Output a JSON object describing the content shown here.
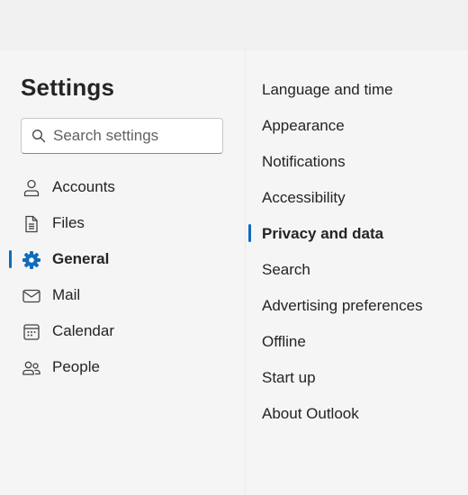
{
  "settings": {
    "title": "Settings",
    "search_placeholder": "Search settings"
  },
  "nav": {
    "items": [
      {
        "label": "Accounts",
        "icon": "person-icon"
      },
      {
        "label": "Files",
        "icon": "document-icon"
      },
      {
        "label": "General",
        "icon": "gear-icon",
        "selected": true
      },
      {
        "label": "Mail",
        "icon": "mail-icon"
      },
      {
        "label": "Calendar",
        "icon": "calendar-icon"
      },
      {
        "label": "People",
        "icon": "people-icon"
      }
    ]
  },
  "general": {
    "items": [
      {
        "label": "Language and time"
      },
      {
        "label": "Appearance"
      },
      {
        "label": "Notifications"
      },
      {
        "label": "Accessibility"
      },
      {
        "label": "Privacy and data",
        "selected": true
      },
      {
        "label": "Search"
      },
      {
        "label": "Advertising preferences"
      },
      {
        "label": "Offline"
      },
      {
        "label": "Start up"
      },
      {
        "label": "About Outlook"
      }
    ]
  },
  "colors": {
    "accent": "#0f6cbd",
    "text": "#242424",
    "pane_background": "#f5f5f5",
    "top_bar": "#f0f0f0"
  }
}
